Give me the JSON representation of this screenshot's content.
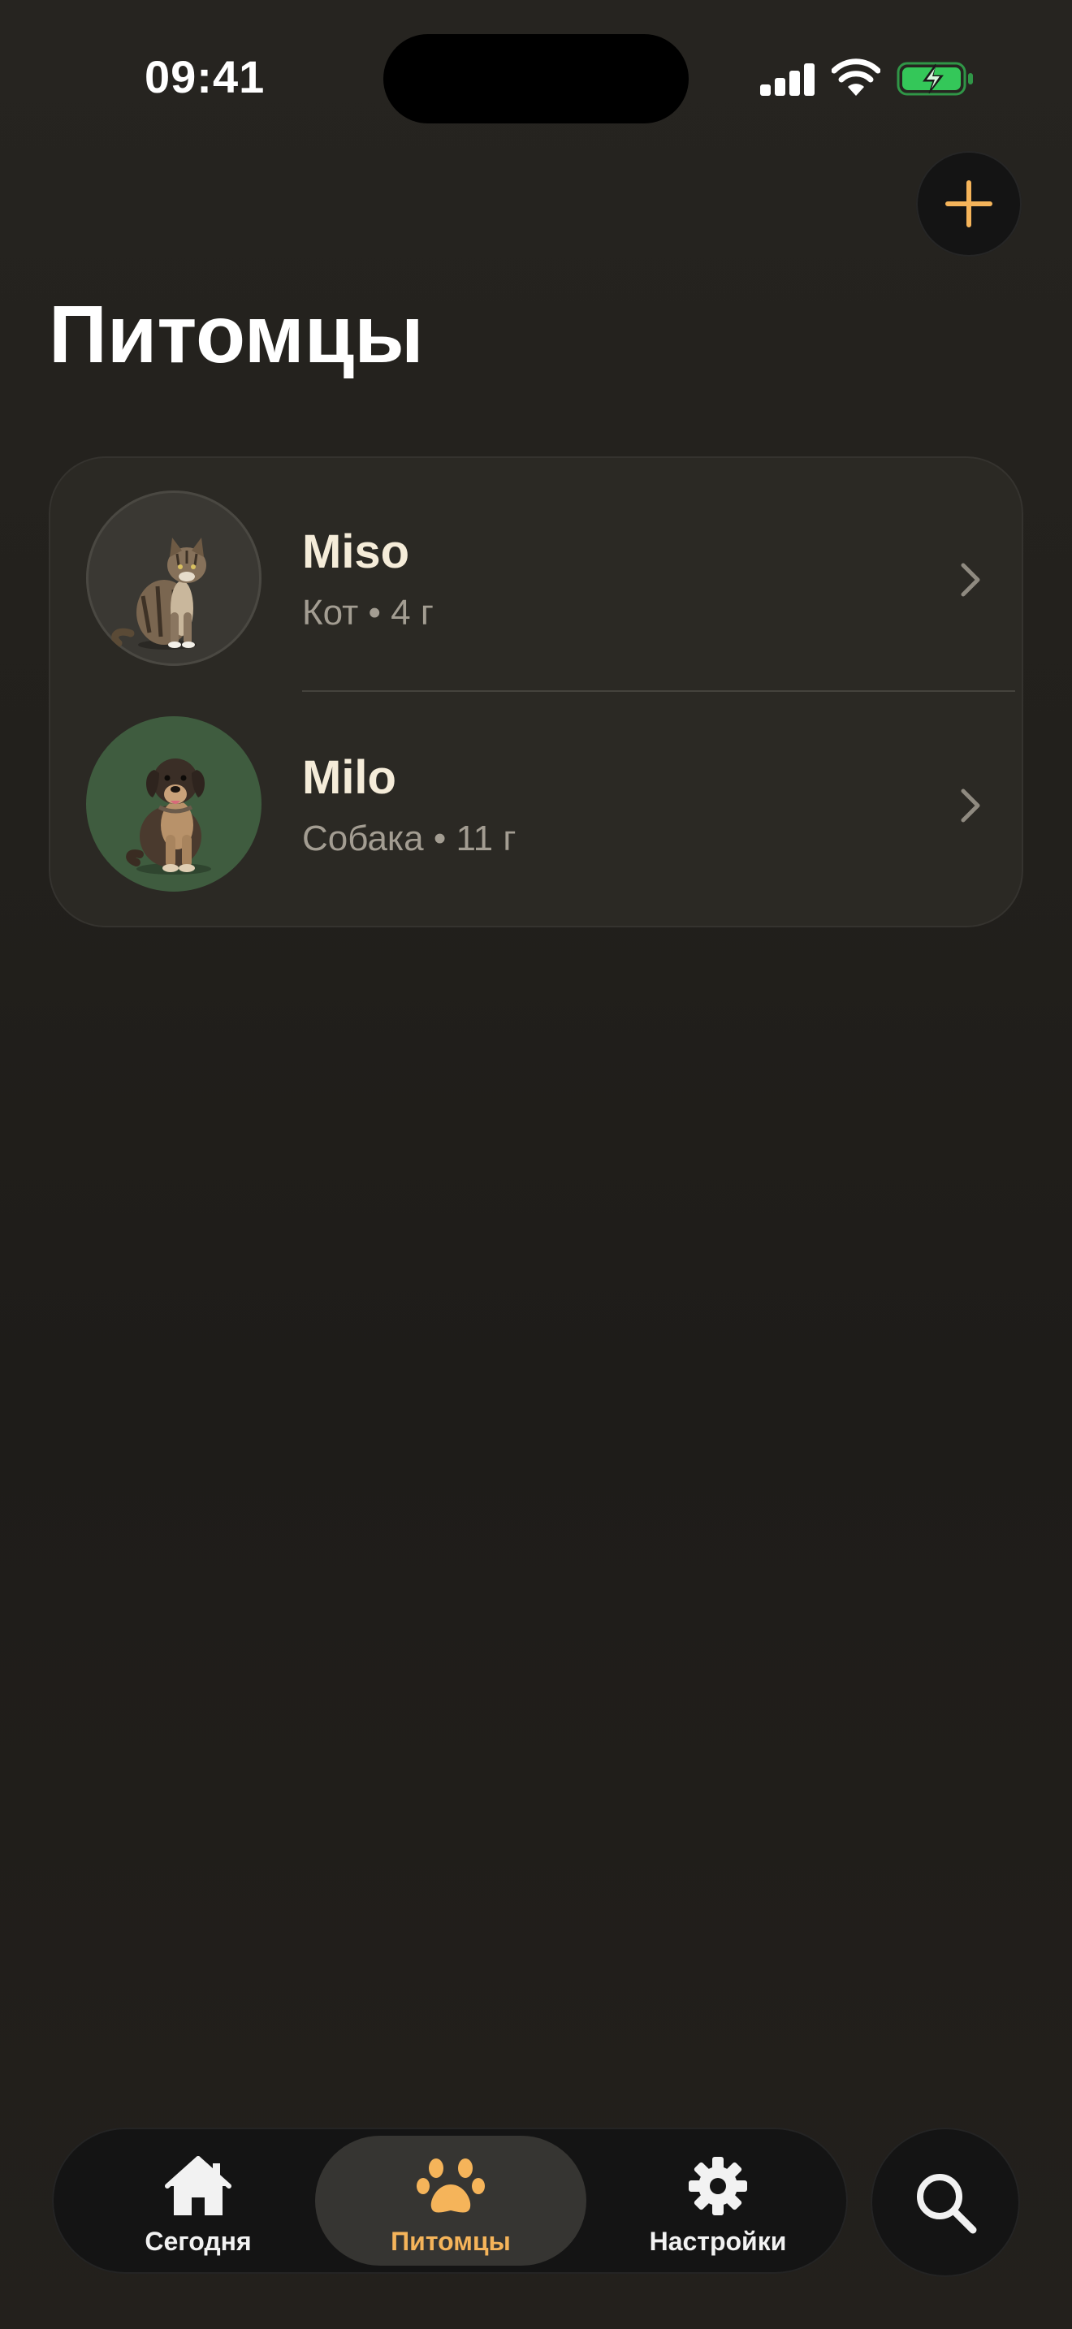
{
  "status_bar": {
    "time": "09:41"
  },
  "header": {
    "title": "Питомцы",
    "add_icon": "plus-icon"
  },
  "pets": [
    {
      "name": "Miso",
      "meta": "Кот • 4 г",
      "avatar": "cat-photo"
    },
    {
      "name": "Milo",
      "meta": "Собака • 11 г",
      "avatar": "dog-photo"
    }
  ],
  "tab_bar": {
    "tabs": [
      {
        "label": "Сегодня",
        "icon": "house-icon"
      },
      {
        "label": "Питомцы",
        "icon": "paw-icon",
        "selected": true
      },
      {
        "label": "Настройки",
        "icon": "gear-icon"
      }
    ],
    "search_icon": "search-icon"
  },
  "colors": {
    "accent": "#F5B45A",
    "battery": "#34C759",
    "avatar_green": "#3F5C3F"
  }
}
